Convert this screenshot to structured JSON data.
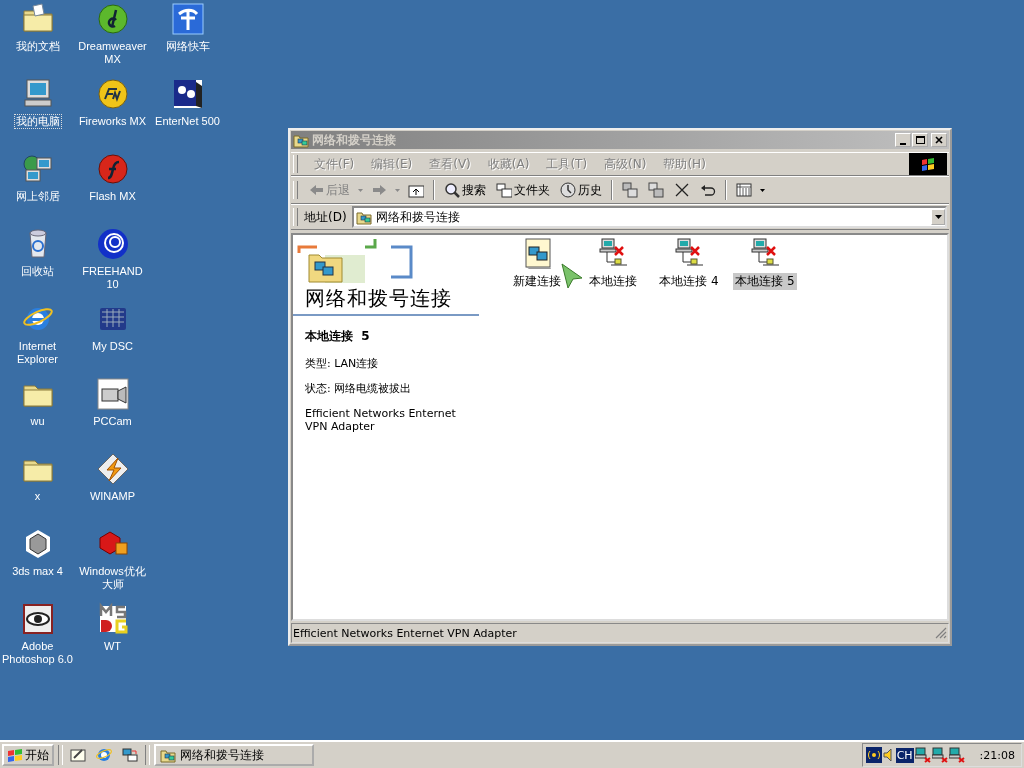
{
  "desktop": {
    "icons": [
      {
        "label": "我的文档",
        "kind": "documents",
        "focused": false
      },
      {
        "label": "我的电脑",
        "kind": "computer",
        "focused": true
      },
      {
        "label": "网上邻居",
        "kind": "neighborhood",
        "focused": false
      },
      {
        "label": "回收站",
        "kind": "recycle",
        "focused": false
      },
      {
        "label": "Internet Explorer",
        "kind": "browser",
        "focused": false
      },
      {
        "label": "wu",
        "kind": "folder",
        "focused": false
      },
      {
        "label": "x",
        "kind": "folder",
        "focused": false
      },
      {
        "label": "3ds max 4",
        "kind": "cube",
        "focused": false
      },
      {
        "label": "Adobe Photoshop 6.0",
        "kind": "eye",
        "focused": false
      },
      {
        "label": "Dreamweaver MX",
        "kind": "disc-green",
        "focused": false
      },
      {
        "label": "Fireworks MX",
        "kind": "disc-yellow",
        "focused": false
      },
      {
        "label": "Flash MX",
        "kind": "disc-red",
        "focused": false
      },
      {
        "label": "FREEHAND 10",
        "kind": "disc-blue",
        "focused": false
      },
      {
        "label": "My DSC",
        "kind": "grid",
        "focused": false
      },
      {
        "label": "PCCam",
        "kind": "camera",
        "focused": false
      },
      {
        "label": "WINAMP",
        "kind": "bolt",
        "focused": false
      },
      {
        "label": "Windows优化大师",
        "kind": "blocks",
        "focused": false
      },
      {
        "label": "WT",
        "kind": "letters",
        "focused": false
      },
      {
        "label": "网络快车",
        "kind": "telecom",
        "focused": false
      },
      {
        "label": "EnterNet 500",
        "kind": "portrait",
        "focused": false
      }
    ]
  },
  "window": {
    "title": "网络和拨号连接",
    "active": false,
    "menu": [
      "文件(F)",
      "编辑(E)",
      "查看(V)",
      "收藏(A)",
      "工具(T)",
      "高级(N)",
      "帮助(H)"
    ],
    "toolbar": [
      {
        "kind": "back",
        "label": "后退",
        "disabled": true
      },
      {
        "kind": "forward",
        "disabled": true
      },
      {
        "kind": "up"
      },
      {
        "kind": "search",
        "label": "搜索"
      },
      {
        "kind": "folders",
        "label": "文件夹"
      },
      {
        "kind": "history",
        "label": "历史"
      },
      {
        "kind": "move"
      },
      {
        "kind": "copy"
      },
      {
        "kind": "delete"
      },
      {
        "kind": "undo"
      },
      {
        "kind": "views"
      }
    ],
    "address": {
      "label": "地址(D)",
      "value": "网络和拨号连接"
    },
    "banner_title": "网络和拨号连接",
    "details": {
      "name": "本地连接  5",
      "type": "类型: LAN连接",
      "status": "状态: 网络电缆被拔出",
      "device": "Efficient Networks Enternet VPN Adapter"
    },
    "connections": [
      {
        "label": "新建连接",
        "kind": "new",
        "disconnected": false,
        "selected": false
      },
      {
        "label": "本地连接",
        "kind": "lan",
        "disconnected": true,
        "selected": false
      },
      {
        "label": "本地连接 4",
        "kind": "lan",
        "disconnected": true,
        "selected": false
      },
      {
        "label": "本地连接 5",
        "kind": "lan",
        "disconnected": true,
        "selected": true
      }
    ],
    "status_bar": "Efficient Networks Enternet VPN Adapter"
  },
  "taskbar": {
    "start": "开始",
    "tasks": [
      {
        "label": "网络和拨号连接",
        "selected": false
      }
    ],
    "ime": "CH",
    "clock": ":21:08"
  }
}
